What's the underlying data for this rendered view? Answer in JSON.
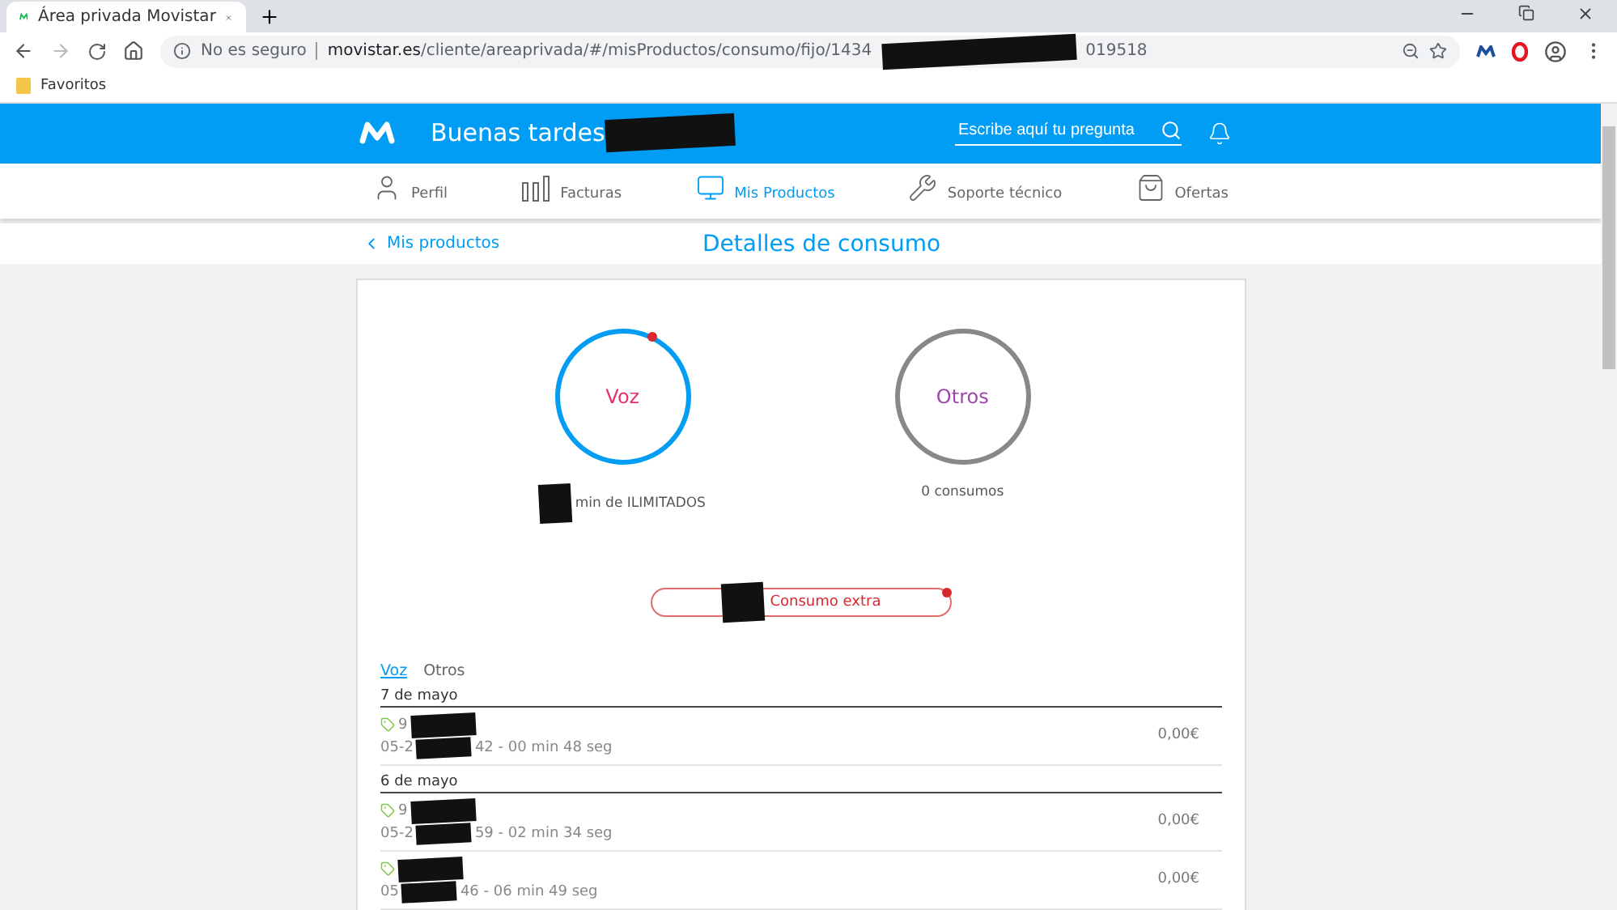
{
  "browser": {
    "tab_title": "Área privada Movistar",
    "security": "No es seguro",
    "url_host": "movistar.es",
    "url_path": "/cliente/areaprivada/#/misProductos/consumo/fijo/1434",
    "url_end": "019518",
    "bookmarks": [
      "Favoritos"
    ]
  },
  "header": {
    "greeting": "Buenas tardes",
    "search_placeholder": "Escribe aquí tu pregunta"
  },
  "nav": [
    {
      "label": "Perfil",
      "kind": "person",
      "selected": false
    },
    {
      "label": "Facturas",
      "kind": "bars",
      "selected": false
    },
    {
      "label": "Mis Productos",
      "kind": "devices",
      "selected": true
    },
    {
      "label": "Soporte técnico",
      "kind": "wrench",
      "selected": false
    },
    {
      "label": "Ofertas",
      "kind": "bag",
      "selected": false
    }
  ],
  "subheader": {
    "back": "Mis productos",
    "title": "Detalles de consumo"
  },
  "gauges": [
    {
      "label": "Voz",
      "kind": "active",
      "caption": "min de ILIMITADOS"
    },
    {
      "label": "Otros",
      "kind": "empty",
      "caption": "0 consumos"
    }
  ],
  "extra_button": "Consumo extra",
  "tabs": [
    {
      "label": "Voz",
      "selected": true
    },
    {
      "label": "Otros",
      "selected": false
    }
  ],
  "groups": [
    {
      "date": "7 de mayo",
      "calls": [
        {
          "number_start": "9",
          "time_start": "05-2",
          "time_end": "42 - 00 min 48 seg",
          "amount": "0,00€"
        }
      ]
    },
    {
      "date": "6 de mayo",
      "calls": [
        {
          "number_start": "9",
          "time_start": "05-2",
          "time_end": "59 - 02 min 34 seg",
          "amount": "0,00€"
        },
        {
          "time_start": "05",
          "time_end": "46 - 06 min 49 seg",
          "amount": "0,00€"
        }
      ]
    }
  ]
}
